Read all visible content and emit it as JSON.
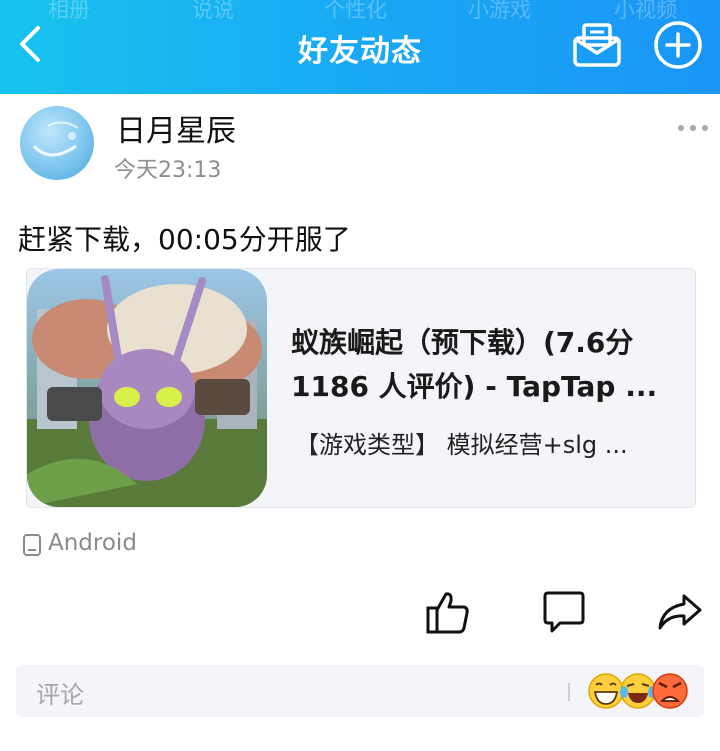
{
  "header": {
    "title": "好友动态",
    "ghost_tabs": [
      "相册",
      "说说",
      "个性化",
      "小游戏",
      "小视频"
    ],
    "background_colors": [
      "#17c3ee",
      "#1a96f6"
    ]
  },
  "post": {
    "username": "日月星辰",
    "time": "今天23:13",
    "text": "赶紧下载，00:05分开服了"
  },
  "link_card": {
    "title_line1": "蚁族崛起（预下载）(7.6分",
    "title_line2": "1186 人评价) - TapTap ...",
    "description": "【游戏类型】 模拟经营+slg ..."
  },
  "device": {
    "label": "Android"
  },
  "comment": {
    "placeholder": "评论"
  },
  "icons": {
    "back": "chevron-left-icon",
    "mail": "mail-icon",
    "plus": "plus-circle-icon",
    "more": "more-dots-icon",
    "like": "thumbs-up-icon",
    "comment": "comment-icon",
    "share": "share-icon",
    "device": "phone-icon"
  },
  "colors": {
    "accent": "#1aa6f5",
    "text_secondary": "#8e8e8e",
    "card_bg": "#f4f5f9"
  }
}
